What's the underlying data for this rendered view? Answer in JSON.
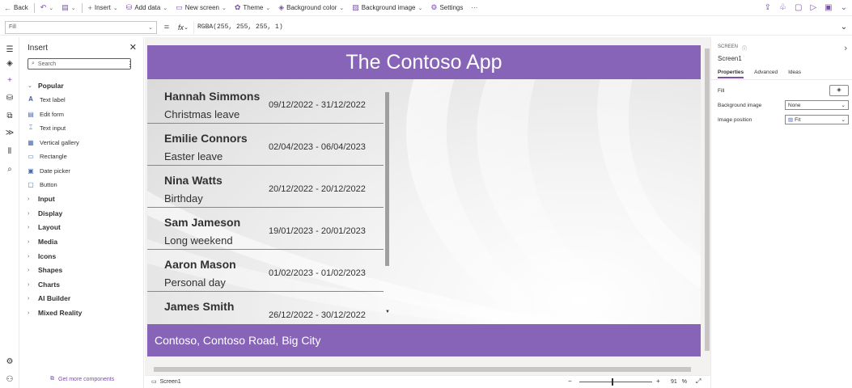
{
  "toolbar": {
    "back": "Back",
    "insert": "Insert",
    "add_data": "Add data",
    "new_screen": "New screen",
    "theme": "Theme",
    "background_color": "Background color",
    "background_image": "Background image",
    "settings": "Settings",
    "more": "···"
  },
  "formula_bar": {
    "property": "Fill",
    "equals": "=",
    "fx": "fx",
    "formula": "RGBA(255, 255, 255, 1)"
  },
  "insert_panel": {
    "title": "Insert",
    "search_placeholder": "Search",
    "popular_label": "Popular",
    "popular_items": [
      {
        "label": "Text label",
        "icon": "text-label-icon"
      },
      {
        "label": "Edit form",
        "icon": "edit-form-icon"
      },
      {
        "label": "Text input",
        "icon": "text-input-icon"
      },
      {
        "label": "Vertical gallery",
        "icon": "gallery-icon"
      },
      {
        "label": "Rectangle",
        "icon": "rectangle-icon"
      },
      {
        "label": "Date picker",
        "icon": "calendar-icon"
      },
      {
        "label": "Button",
        "icon": "button-icon"
      }
    ],
    "categories": [
      "Input",
      "Display",
      "Layout",
      "Media",
      "Icons",
      "Shapes",
      "Charts",
      "AI Builder",
      "Mixed Reality"
    ],
    "get_more": "Get more components"
  },
  "app": {
    "title": "The Contoso App",
    "footer": "Contoso, Contoso Road, Big City",
    "header_color": "#8764b8",
    "gallery": [
      {
        "name": "Hannah Simmons",
        "reason": "Christmas leave",
        "dates": "09/12/2022 - 31/12/2022"
      },
      {
        "name": "Emilie Connors",
        "reason": "Easter leave",
        "dates": "02/04/2023 - 06/04/2023"
      },
      {
        "name": "Nina Watts",
        "reason": "Birthday",
        "dates": "20/12/2022 - 20/12/2022"
      },
      {
        "name": "Sam Jameson",
        "reason": "Long weekend",
        "dates": "19/01/2023 - 20/01/2023"
      },
      {
        "name": "Aaron Mason",
        "reason": "Personal day",
        "dates": "01/02/2023 - 01/02/2023"
      },
      {
        "name": "James Smith",
        "reason": "",
        "dates": "26/12/2022 - 30/12/2022"
      }
    ]
  },
  "status_bar": {
    "screen_tab": "Screen1",
    "zoom_value": "91",
    "zoom_unit": "%",
    "zoom_minus": "−",
    "zoom_plus": "+"
  },
  "properties": {
    "kind": "SCREEN",
    "name": "Screen1",
    "tabs": [
      "Properties",
      "Advanced",
      "Ideas"
    ],
    "fill_label": "Fill",
    "background_image_label": "Background image",
    "background_image_value": "None",
    "image_position_label": "Image position",
    "image_position_value": "Fit"
  }
}
